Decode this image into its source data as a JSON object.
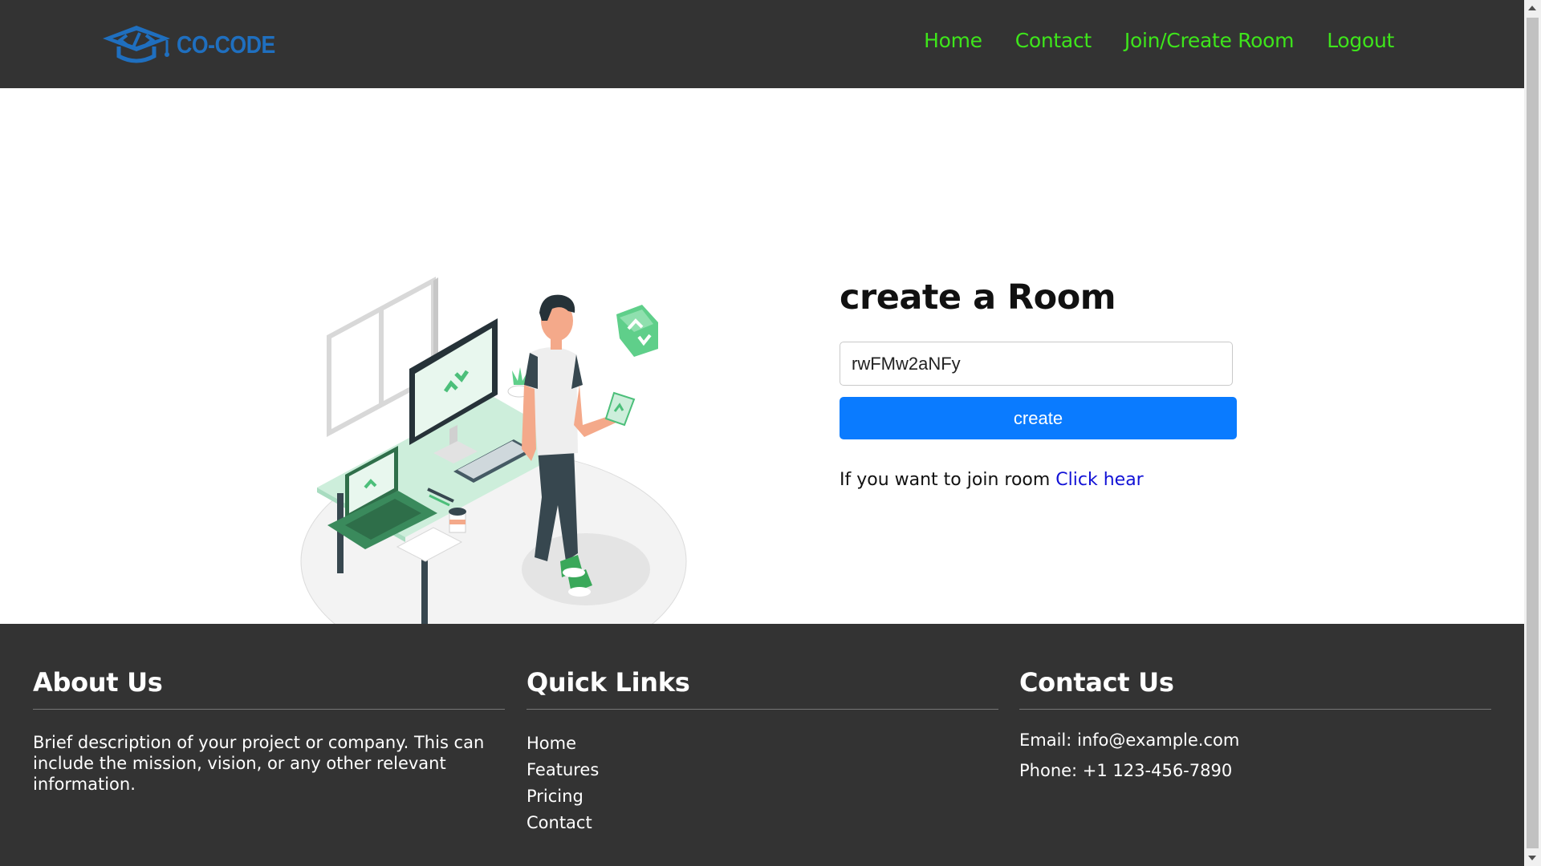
{
  "header": {
    "logo_text": "CO-CODE",
    "logo_icon": "graduation-cap-code-icon",
    "nav": [
      {
        "label": "Home"
      },
      {
        "label": "Contact"
      },
      {
        "label": "Join/Create Room"
      },
      {
        "label": "Logout"
      }
    ]
  },
  "main": {
    "illustration": "person-at-desk-illustration",
    "form": {
      "title": "create a Room",
      "room_id_value": "rwFMw2aNFy",
      "create_label": "create",
      "join_prompt": "If you want to join room",
      "join_link": "Click hear"
    }
  },
  "footer": {
    "about": {
      "title": "About Us",
      "text": "Brief description of your project or company. This can include the mission, vision, or any other relevant information."
    },
    "quick_links": {
      "title": "Quick Links",
      "items": [
        "Home",
        "Features",
        "Pricing",
        "Contact"
      ]
    },
    "contact": {
      "title": "Contact Us",
      "email": "Email: info@example.com",
      "phone": "Phone: +1 123-456-7890"
    }
  },
  "colors": {
    "header_bg": "#333333",
    "nav_link": "#3ee51b",
    "logo_blue": "#1f6fbf",
    "button_blue": "#0a7bff",
    "link_blue": "#1212d6",
    "accent_green": "#5fcf8a"
  }
}
